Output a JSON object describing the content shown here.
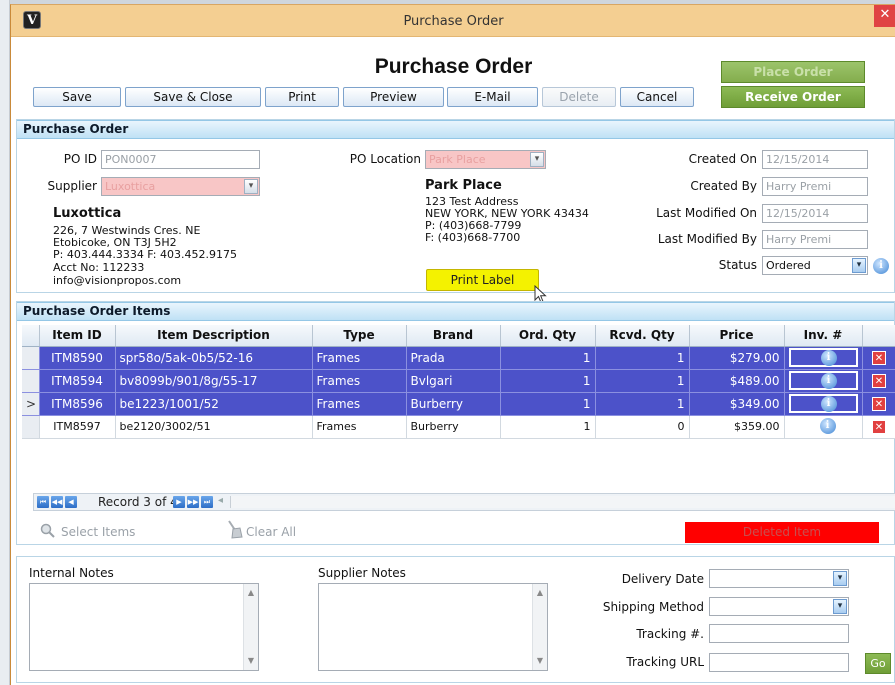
{
  "window": {
    "title": "Purchase Order",
    "app_icon": "V"
  },
  "form_title": "Purchase Order",
  "toolbar": {
    "save": "Save",
    "save_close": "Save & Close",
    "print": "Print",
    "preview": "Preview",
    "email": "E-Mail",
    "delete": "Delete",
    "cancel": "Cancel",
    "place_order": "Place Order",
    "receive_order": "Receive Order"
  },
  "po_section": {
    "header": "Purchase Order",
    "po_id_label": "PO ID",
    "po_id_value": "PON0007",
    "supplier_label": "Supplier",
    "supplier_value": "Luxottica",
    "supplier_name": "Luxottica",
    "supplier_address": [
      "226, 7 Westwinds Cres. NE",
      "Etobicoke, ON T3J 5H2",
      "P: 403.444.3334 F: 403.452.9175",
      "Acct No: 112233",
      "info@visionpropos.com"
    ],
    "location_label": "PO Location",
    "location_value": "Park Place",
    "location_name": "Park Place",
    "location_address": [
      "123 Test Address",
      "NEW YORK, NEW YORK 43434",
      "P: (403)668-7799",
      "F: (403)668-7700"
    ],
    "print_label": "Print Label",
    "created_on_label": "Created On",
    "created_on_value": "12/15/2014",
    "created_by_label": "Created By",
    "created_by_value": "Harry Premi",
    "modified_on_label": "Last Modified On",
    "modified_on_value": "12/15/2014",
    "modified_by_label": "Last Modified By",
    "modified_by_value": "Harry Premi",
    "status_label": "Status",
    "status_value": "Ordered"
  },
  "items_section": {
    "header": "Purchase Order Items",
    "columns": [
      "Item ID",
      "Item Description",
      "Type",
      "Brand",
      "Ord. Qty",
      "Rcvd. Qty",
      "Price",
      "Inv. #"
    ],
    "rows": [
      {
        "id": "ITM8590",
        "desc": "spr58o/5ak-0b5/52-16",
        "type": "Frames",
        "brand": "Prada",
        "ord": "1",
        "rcvd": "1",
        "price": "$279.00",
        "indicator": "",
        "selected": true
      },
      {
        "id": "ITM8594",
        "desc": "bv8099b/901/8g/55-17",
        "type": "Frames",
        "brand": "Bvlgari",
        "ord": "1",
        "rcvd": "1",
        "price": "$489.00",
        "indicator": "",
        "selected": true
      },
      {
        "id": "ITM8596",
        "desc": "be1223/1001/52",
        "type": "Frames",
        "brand": "Burberry",
        "ord": "1",
        "rcvd": "1",
        "price": "$349.00",
        "indicator": ">",
        "selected": true
      },
      {
        "id": "ITM8597",
        "desc": "be2120/3002/51",
        "type": "Frames",
        "brand": "Burberry",
        "ord": "1",
        "rcvd": "0",
        "price": "$359.00",
        "indicator": "",
        "selected": false
      }
    ],
    "record_text": "Record 3 of 4",
    "select_items": "Select Items",
    "clear_all": "Clear All",
    "deleted_item": "Deleted Item"
  },
  "notes": {
    "internal_label": "Internal Notes",
    "supplier_label": "Supplier Notes",
    "delivery_date_label": "Delivery Date",
    "shipping_method_label": "Shipping Method",
    "tracking_no_label": "Tracking #.",
    "tracking_url_label": "Tracking URL",
    "go": "Go"
  },
  "colors": {
    "selected_row": "#4c52c9",
    "green_button": "#6f9e37",
    "section_header": "#bfe1f5",
    "deleted": "#ff0000",
    "titlebar": "#f4cf92"
  }
}
